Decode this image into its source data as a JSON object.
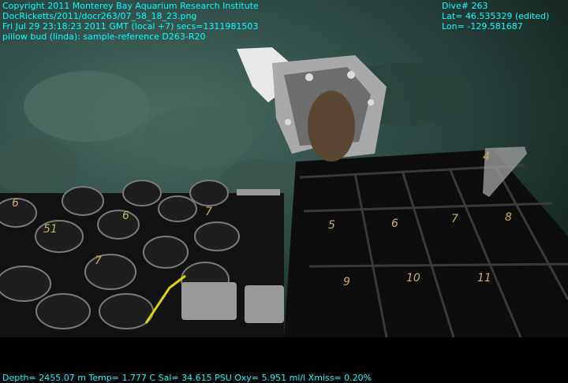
{
  "overlay": {
    "top_left": [
      "Copyright 2011 Monterey Bay Aquarium Research Institute",
      "DocRicketts/2011/docr263/07_58_18_23.png",
      "Fri Jul 29 23:18:23 2011 GMT (local +7)  secs=1311981503",
      "pillow bud (linda): sample-reference D263-R20"
    ],
    "top_right": [
      "Dive# 263",
      "Lat= 46.535329 (edited)",
      "Lon= -129.581687"
    ],
    "bottom": "Depth= 2455.07 m  Temp= 1.777 C  Sal= 34.615 PSU  Oxy= 5.951 ml/l  Xmiss= 0.20%"
  },
  "scene": {
    "tray_cell_numbers": [
      "4",
      "5",
      "6",
      "7",
      "8",
      "9",
      "10",
      "11"
    ],
    "sampler_labels": [
      "6",
      "51",
      "7",
      "6",
      "7"
    ],
    "colors": {
      "overlay_text": "#00ffff",
      "water": "#33504a",
      "tray": "#0d0d0d",
      "cell_number": "#c8b062"
    }
  }
}
